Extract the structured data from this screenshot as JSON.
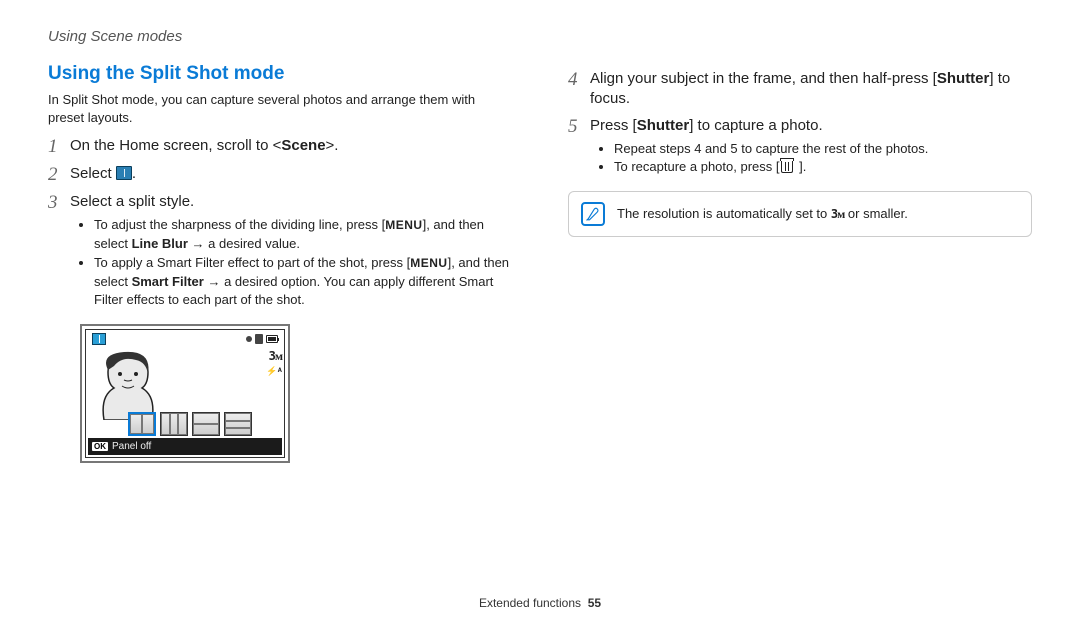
{
  "header": "Using Scene modes",
  "title": "Using the Split Shot mode",
  "intro": "In Split Shot mode, you can capture several photos and arrange them with preset layouts.",
  "steps_left": {
    "s1": {
      "num": "1",
      "pre": "On the Home screen, scroll to <",
      "bold": "Scene",
      "post": ">."
    },
    "s2": {
      "num": "2",
      "text": "Select",
      "iconName": "split-shot-icon",
      "tail": "."
    },
    "s3": {
      "num": "3",
      "text": "Select a split style."
    }
  },
  "bullets_left": {
    "b1": {
      "pre": "To adjust the sharpness of the dividing line, press [",
      "menu": "MENU",
      "mid": "], and then select ",
      "bold": "Line Blur",
      "arrow": " → ",
      "tail": "a desired value."
    },
    "b2": {
      "pre": "To apply a Smart Filter effect to part of the shot, press [",
      "menu": "MENU",
      "mid": "], and then select ",
      "bold": "Smart Filter",
      "arrow": " → ",
      "tail": "a desired option. You can apply different Smart Filter effects to each part of the shot."
    }
  },
  "camera": {
    "res": "3ᴍ",
    "flash": "⚡ᴬ",
    "panel_label": "Panel off",
    "ok": "OK"
  },
  "steps_right": {
    "s4": {
      "num": "4",
      "pre": "Align your subject in the frame, and then half-press [",
      "bold": "Shutter",
      "post": "] to focus."
    },
    "s5": {
      "num": "5",
      "pre": "Press [",
      "bold": "Shutter",
      "post": "] to capture a photo."
    }
  },
  "bullets_right": {
    "b1": "Repeat steps 4 and 5 to capture the rest of the photos.",
    "b2": {
      "pre": "To recapture a photo, press [",
      "iconName": "trash-icon",
      "post": " ]."
    }
  },
  "note": {
    "pre": "The resolution is automatically set to ",
    "res": "3ᴍ",
    "post": " or smaller."
  },
  "footer": {
    "section": "Extended functions",
    "page": "55"
  }
}
